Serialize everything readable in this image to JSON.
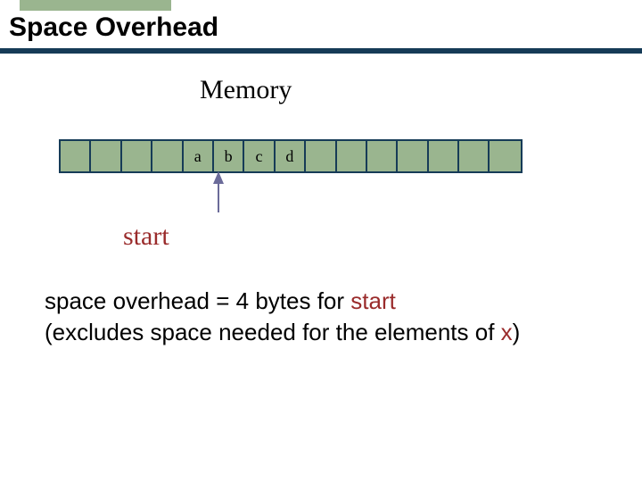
{
  "title": "Space Overhead",
  "memory_label": "Memory",
  "cells": {
    "c0": "",
    "c1": "",
    "c2": "",
    "c3": "",
    "c4": "a",
    "c5": "b",
    "c6": "c",
    "c7": "d",
    "c8": "",
    "c9": "",
    "c10": "",
    "c11": "",
    "c12": "",
    "c13": "",
    "c14": ""
  },
  "start_label": "start",
  "body": {
    "line1_a": "space overhead = 4 bytes for ",
    "line1_start": "start",
    "line2_a": "(excludes space needed for the elements of ",
    "line2_x": "x",
    "line2_b": ")"
  }
}
